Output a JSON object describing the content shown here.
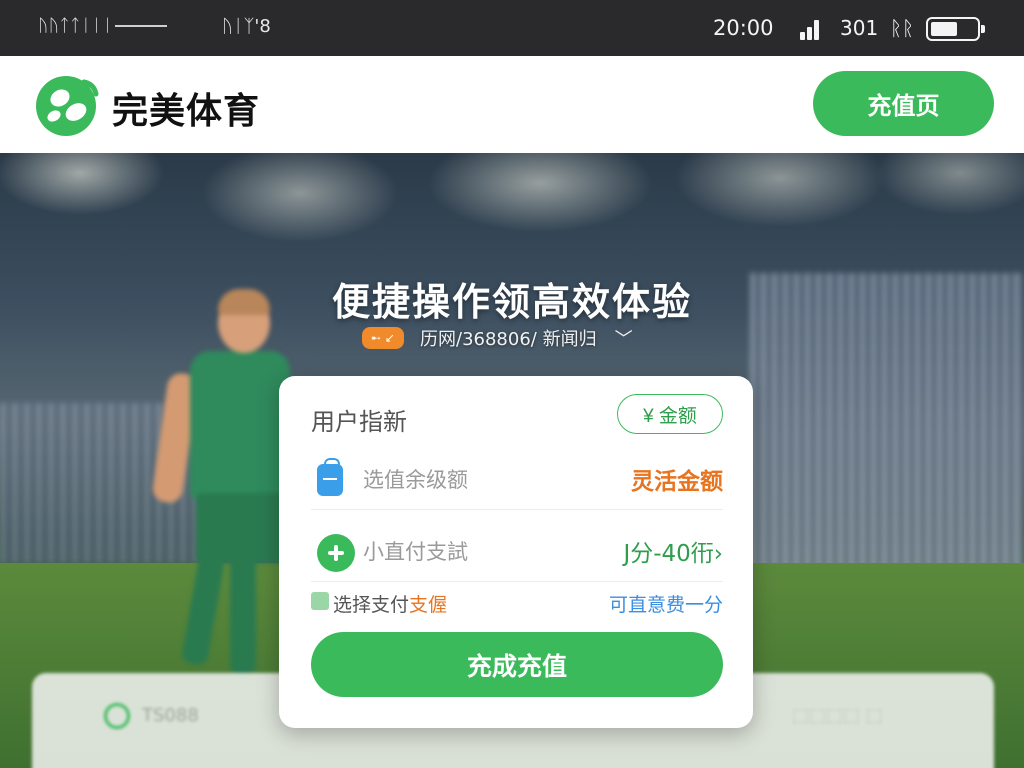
{
  "status_bar": {
    "left_text": "ᚢᚢᛏᛏᛁᛁᛁ",
    "mid_text": "ᚢᛁᛉ'8",
    "time": "20:00",
    "network": "301",
    "network_extra": "ᚱᚱ",
    "battery_level": 0.6
  },
  "header": {
    "brand": "完美体育",
    "recharge_button": "充值页",
    "accent_color": "#3bba5c"
  },
  "hero": {
    "title": "便捷操作领高效体验",
    "badge": "➸ ↙",
    "subtitle": "历网/368806/ 新闻归",
    "chevron": "﹀"
  },
  "background_panel": {
    "left_text": "TS088",
    "right_text": "⬚⬚⬚⬚ ⬚"
  },
  "card": {
    "title": "用户指新",
    "amount_button": "¥ 金额",
    "row1": {
      "label": "选值余级额",
      "value": "灵活金额"
    },
    "row2": {
      "label": "小直付支試",
      "value": "J分-40衎›"
    },
    "pay_label_prefix": "选择支付",
    "pay_label_highlight": "支偓",
    "pay_right": "可直意费一分",
    "confirm_button": "充成充值"
  },
  "icons": [
    "logo-icon",
    "signal-icon",
    "battery-icon",
    "bag-icon",
    "plus-circle-icon",
    "checkbox-icon",
    "chevron-down-icon"
  ]
}
